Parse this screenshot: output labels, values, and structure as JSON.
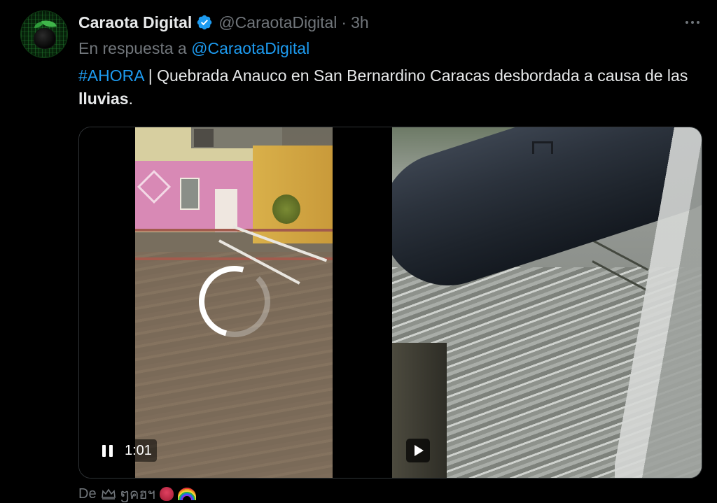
{
  "tweet": {
    "display_name": "Caraota Digital",
    "handle": "@CaraotaDigital",
    "separator": "·",
    "time": "3h",
    "reply_prefix": "En respuesta a",
    "reply_to": "@CaraotaDigital",
    "hashtag": "#AHORA",
    "text_part1": " | Quebrada Anauco en San Bernardino Caracas desbordada a causa de las ",
    "text_bold": "lluvias",
    "text_part2": "."
  },
  "media": {
    "left_video": {
      "state": "playing",
      "time": "1:01",
      "loading": true
    },
    "right_video": {
      "state": "paused"
    }
  },
  "footer": {
    "prefix": "De",
    "user_text": "ໆคฮฯ"
  },
  "colors": {
    "background": "#000000",
    "text": "#e7e9ea",
    "muted": "#71767b",
    "accent": "#1d9bf0"
  },
  "icons": [
    "verified-badge-icon",
    "more-options-icon",
    "pause-icon",
    "play-icon",
    "crown-icon",
    "heart-emoji-icon",
    "rainbow-emoji-icon"
  ]
}
